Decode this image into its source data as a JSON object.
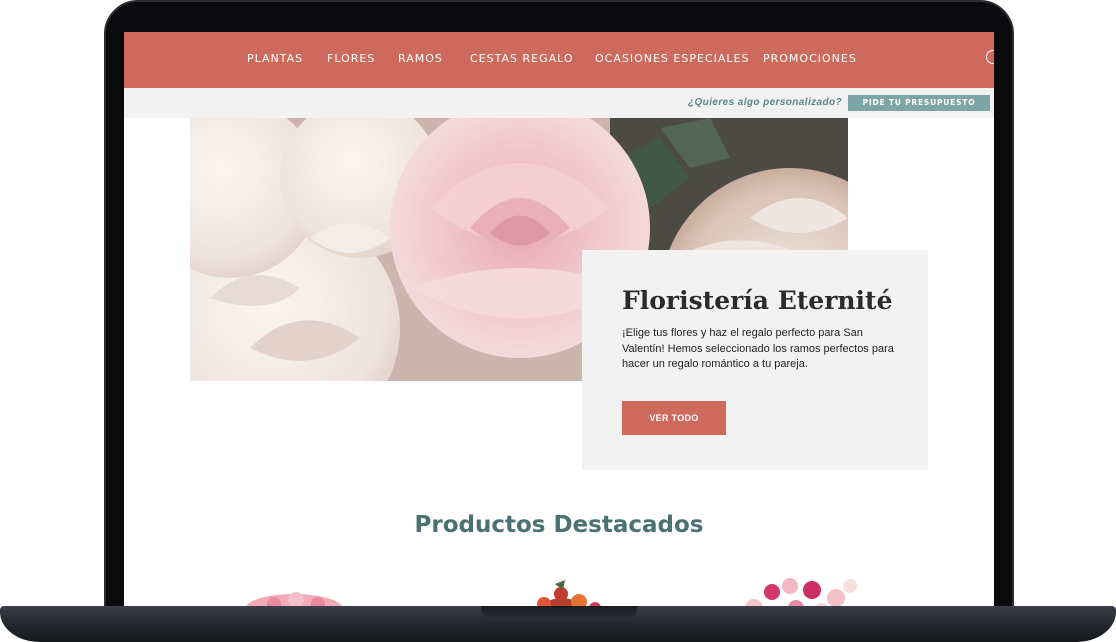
{
  "nav": {
    "items": [
      {
        "label": "PLANTAS"
      },
      {
        "label": "FLORES"
      },
      {
        "label": "RAMOS"
      },
      {
        "label": "CESTAS REGALO"
      },
      {
        "label": "OCASIONES ESPECIALES"
      },
      {
        "label": "PROMOCIONES"
      }
    ],
    "search_icon": "search-icon"
  },
  "subbar": {
    "question": "¿Quieres algo personalizado?",
    "button_label": "PIDE TU PRESUPUESTO"
  },
  "hero": {
    "title": "Floristería Eternité",
    "text": "¡Elige tus flores y haz el regalo perfecto para San Valentín! Hemos seleccionado los ramos perfectos para hacer un regalo romántico a tu pareja.",
    "button_label": "VER TODO"
  },
  "featured": {
    "title": "Productos Destacados",
    "products": [
      {
        "image": "pink-bouquet"
      },
      {
        "image": "red-bouquet"
      },
      {
        "image": "pink-white-bouquet"
      }
    ]
  },
  "colors": {
    "nav_bg": "#cd6a5c",
    "accent_teal": "#7ea5a5",
    "title_teal": "#4a7272",
    "card_bg": "#f2f2f2"
  }
}
